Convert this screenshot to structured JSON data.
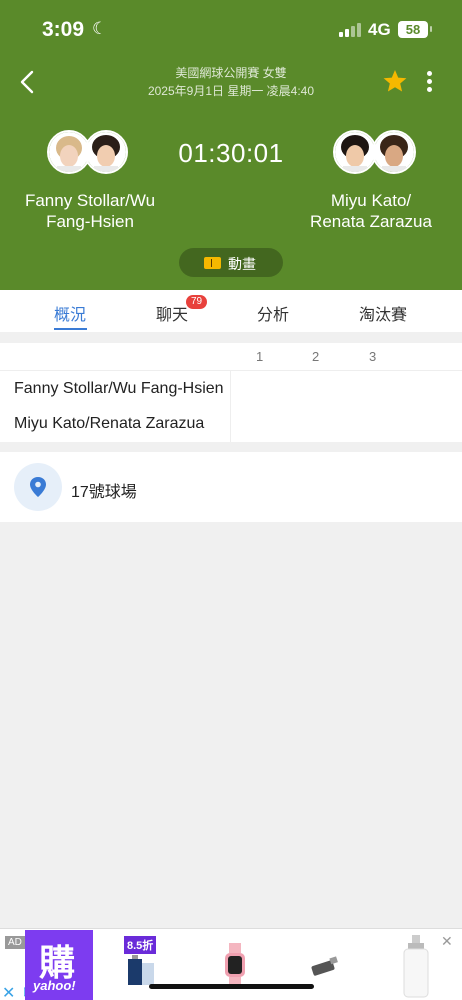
{
  "status_bar": {
    "time": "3:09",
    "network": "4G",
    "battery": "58"
  },
  "header": {
    "competition": "美國網球公開賽 女雙",
    "datetime": "2025年9月1日 星期一 凌晨4:40",
    "score_time": "01:30:01",
    "favorite_color": "#f5b800",
    "animation_label": "動畫"
  },
  "teams": {
    "home": {
      "line1": "Fanny Stollar/Wu",
      "line2": "Fang-Hsien"
    },
    "away": {
      "line1": "Miyu Kato/",
      "line2": "Renata Zarazua"
    }
  },
  "tabs": [
    {
      "label": "概況",
      "active": true
    },
    {
      "label": "聊天",
      "badge": "79"
    },
    {
      "label": "分析"
    },
    {
      "label": "淘汰賽"
    }
  ],
  "scoreboard": {
    "set_headers": [
      "1",
      "2",
      "3"
    ],
    "rows": [
      {
        "name": "Fanny Stollar/Wu Fang-Hsien"
      },
      {
        "name": "Miyu Kato/Renata Zarazua"
      }
    ]
  },
  "venue": {
    "name": "17號球場"
  },
  "ad": {
    "label": "AD",
    "brand_big": "購",
    "brand_small": "yahoo!",
    "discount": "8.5折"
  },
  "colors": {
    "header_bg": "#5a8a2a",
    "accent": "#3a7bd5",
    "badge": "#e8413c"
  }
}
